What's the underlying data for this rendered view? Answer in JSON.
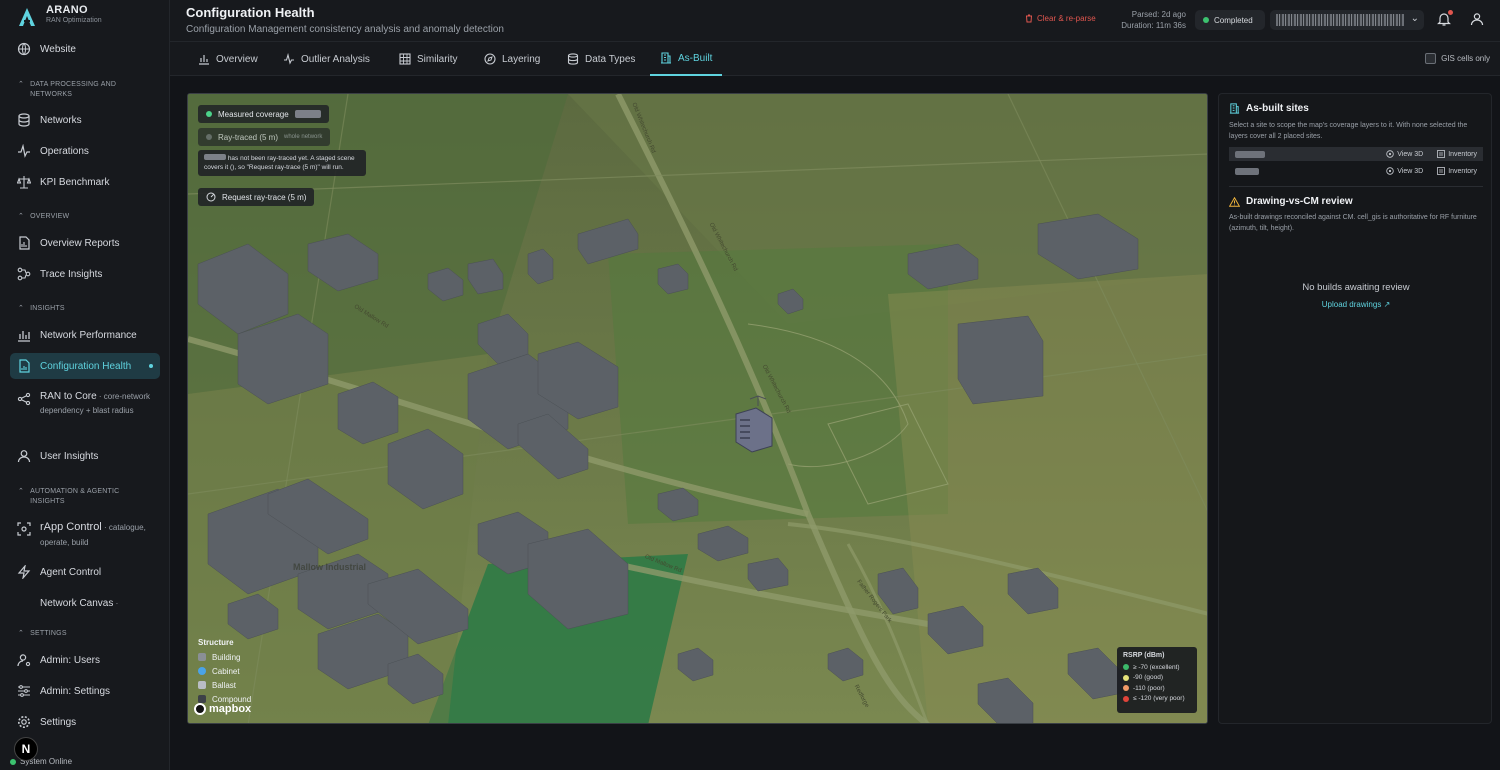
{
  "brand": {
    "name": "ARANO",
    "sub": "RAN Optimization"
  },
  "sidebar": {
    "website": "Website",
    "sec_data": "DATA PROCESSING AND NETWORKS",
    "networks": "Networks",
    "operations": "Operations",
    "kpi": "KPI Benchmark",
    "sec_overview": "OVERVIEW",
    "overview_reports": "Overview Reports",
    "trace_insights": "Trace Insights",
    "sec_insights": "INSIGHTS",
    "network_performance": "Network Performance",
    "configuration_health": "Configuration Health",
    "ran_to_core": "RAN to Core",
    "ran_to_core_hint": " · core-network dependency + blast radius",
    "user_insights": "User Insights",
    "sec_automation": "AUTOMATION & AGENTIC INSIGHTS",
    "rapp_control": "rApp Control",
    "rapp_hint": " · catalogue, operate, build",
    "agent_control": "Agent Control",
    "network_canvas": "Network Canvas",
    "network_canvas_hint": " ·",
    "sec_settings": "SETTINGS",
    "admin_users": "Admin: Users",
    "admin_settings": "Admin: Settings",
    "settings": "Settings",
    "system_online": "System Online",
    "n_badge": "N"
  },
  "header": {
    "title": "Configuration Health",
    "subtitle": "Configuration Management consistency analysis and anomaly detection",
    "clear": "Clear & re-parse",
    "parsed": "Parsed: 2d ago",
    "duration": "Duration: 11m 36s",
    "status": "Completed"
  },
  "tabs": [
    {
      "label": "Overview"
    },
    {
      "label": "Outlier Analysis"
    },
    {
      "label": "Similarity"
    },
    {
      "label": "Layering"
    },
    {
      "label": "Data Types"
    },
    {
      "label": "As-Built"
    }
  ],
  "gis_only": "GIS cells only",
  "map": {
    "measured": "Measured coverage",
    "raytraced": "Ray-traced (5 m)",
    "raytraced_tag": "whole network",
    "note": "has not been ray-traced yet. A staged scene covers it (), so \"Request ray-trace (5 m)\" will run.",
    "request": "Request ray-trace (5 m)",
    "streets": {
      "s1": "Old Whitechurch Rd",
      "s2": "Old Mallow Rd",
      "s3": "Old Whitechurch Rd",
      "s4": "Old Whitechurch Rd",
      "s5": "Old Mallow Rd",
      "s6": "Father Rogers Park",
      "s7": "Redforge",
      "s8": "Mallow Industrial"
    },
    "structure_title": "Structure",
    "structure": [
      "Building",
      "Cabinet",
      "Ballast",
      "Compound"
    ],
    "structure_colors": [
      "#8a8f96",
      "#4aa3e8",
      "#b9bdc4",
      "#3d4147"
    ],
    "mapbox": "mapbox",
    "rsrp_title": "RSRP (dBm)",
    "rsrp": [
      "≥ -70 (excellent)",
      "-90 (good)",
      "-110 (poor)",
      "≤ -120 (very poor)"
    ],
    "rsrp_colors": [
      "#3cb96a",
      "#e5e27a",
      "#f39b68",
      "#e0443a"
    ]
  },
  "panel": {
    "title": "As-built sites",
    "desc": "Select a site to scope the map's coverage layers to it. With none selected the layers cover all 2 placed sites.",
    "view3d": "View 3D",
    "inventory": "Inventory",
    "dv_title": "Drawing-vs-CM review",
    "dv_desc": "As-built drawings reconciled against CM. cell_gis is authoritative for RF furniture (azimuth, tilt, height).",
    "empty": "No builds awaiting review",
    "upload": "Upload drawings"
  },
  "colors": {
    "accent": "#5fd3df",
    "danger": "#e0564f",
    "ok": "#3cc26f"
  }
}
